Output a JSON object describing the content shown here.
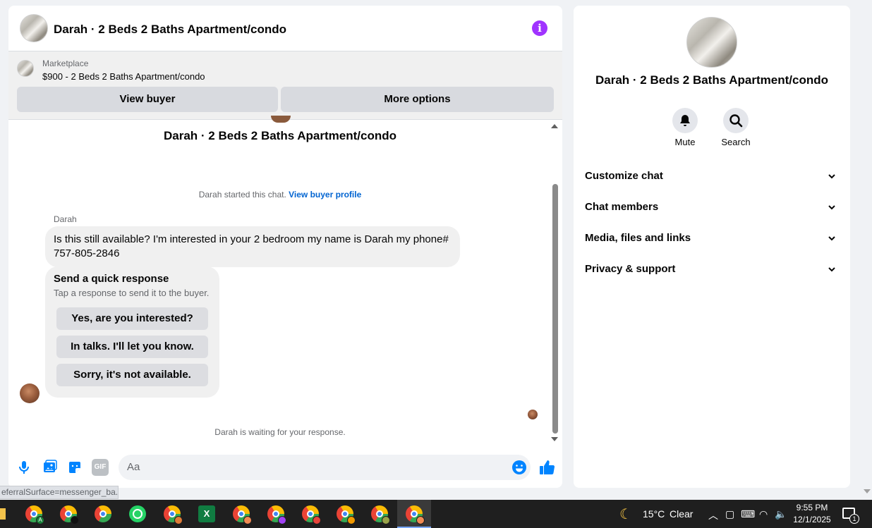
{
  "chat": {
    "title": "Darah · 2 Beds 2 Baths Apartment/condo",
    "listing": {
      "source": "Marketplace",
      "price_title": "$900 - 2 Beds 2 Baths Apartment/condo"
    },
    "buttons": {
      "view_buyer": "View buyer",
      "more_options": "More options"
    },
    "thread_title": "Darah · 2 Beds 2 Baths Apartment/condo",
    "started": {
      "text": "Darah started this chat.",
      "link": "View buyer profile"
    },
    "sender_name": "Darah",
    "message": "Is this still available? I'm interested in your 2 bedroom my name is Darah my phone# 757-805-2846",
    "quick_response": {
      "title": "Send a quick response",
      "subtitle": "Tap a response to send it to the buyer.",
      "options": [
        "Yes, are you interested?",
        "In talks. I'll let you know.",
        "Sorry, it's not available."
      ]
    },
    "waiting_text": "Darah is waiting for your response.",
    "composer": {
      "placeholder": "Aa",
      "icons": [
        "microphone-icon",
        "image-icon",
        "sticker-icon",
        "gif-icon",
        "emoji-icon",
        "like-icon"
      ],
      "gif_label": "GIF"
    }
  },
  "info_panel": {
    "title": "Darah · 2 Beds 2 Baths Apartment/condo",
    "actions": [
      {
        "icon": "bell-icon",
        "label": "Mute"
      },
      {
        "icon": "search-icon",
        "label": "Search"
      }
    ],
    "sections": [
      "Customize chat",
      "Chat members",
      "Media, files and links",
      "Privacy & support"
    ]
  },
  "status_url": "eferralSurface=messenger_ba...",
  "taskbar": {
    "weather_temp": "15°C",
    "weather_desc": "Clear",
    "time": "9:55 PM",
    "date": "12/1/2025",
    "notification_count": "1",
    "excel_label": "X",
    "chrome_profile_letter": "A"
  },
  "colors": {
    "accent": "#0084ff",
    "info": "#a033ff",
    "link": "#0064d1"
  }
}
